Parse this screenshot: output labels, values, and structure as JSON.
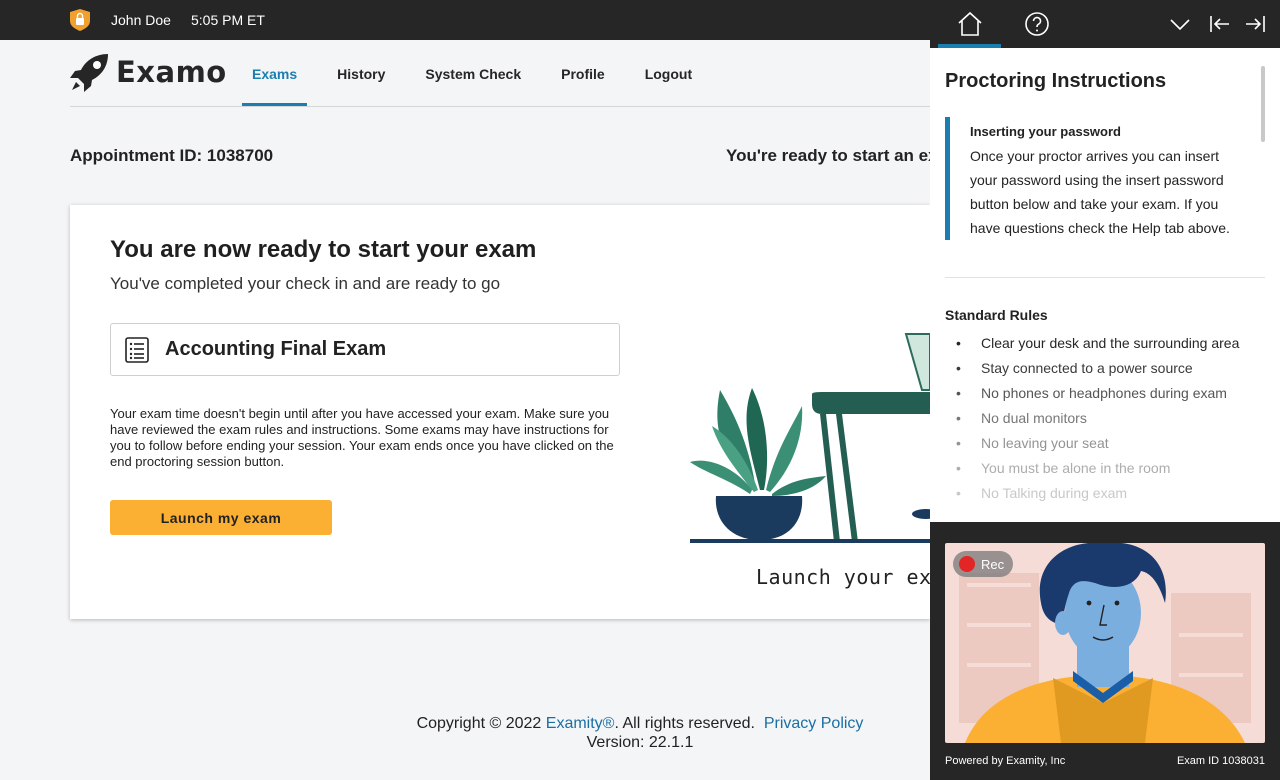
{
  "topbar": {
    "user": "John Doe",
    "time": "5:05 PM ET"
  },
  "brand": {
    "name": "Examo"
  },
  "nav": {
    "items": [
      {
        "label": "Exams"
      },
      {
        "label": "History"
      },
      {
        "label": "System Check"
      },
      {
        "label": "Profile"
      },
      {
        "label": "Logout"
      }
    ],
    "active": "Exams"
  },
  "appointment": {
    "label": "Appointment ID: 1038700",
    "ready": "You're ready to start an ex"
  },
  "card": {
    "title": "You are now ready to start your exam",
    "subtitle": "You've completed your check in and are ready to go",
    "exam_name": "Accounting Final Exam",
    "description": "Your exam time doesn't begin until after you have accessed your exam. Make sure you have reviewed the exam rules and instructions. Some exams may have instructions for you to follow before ending your session. Your exam ends once you have clicked on the end proctoring session button.",
    "launch_label": "Launch my exam",
    "illustration_caption": "Launch your exa"
  },
  "footer": {
    "copyright": "Copyright © 2022",
    "company": "Examity®",
    "rights": ".  All rights reserved.",
    "privacy": "Privacy Policy",
    "version": "Version: 22.1.1"
  },
  "panel": {
    "title": "Proctoring Instructions",
    "callout_title": "Inserting your password",
    "callout_body": "Once your proctor arrives you can insert your password using the insert password button below and take your exam. If you have questions check the Help tab above.",
    "rules_title": "Standard Rules",
    "rules": [
      "Clear your desk and the surrounding area",
      "Stay connected to a power source",
      "No phones or headphones during exam",
      "No dual monitors",
      "No leaving your seat",
      "You must be alone in the room",
      "No Talking during exam"
    ],
    "rec_label": "Rec",
    "powered_by": "Powered by Examity, Inc",
    "exam_id": "Exam ID 1038031"
  },
  "colors": {
    "accent": "#1a7fb0",
    "button": "#fbb034",
    "dark": "#262626",
    "rec": "#e32525"
  }
}
